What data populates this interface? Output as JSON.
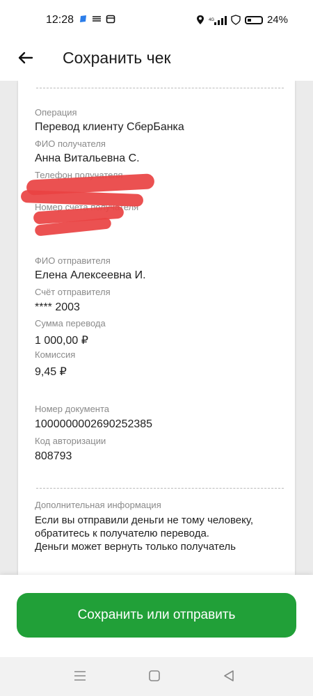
{
  "status_bar": {
    "time": "12:28",
    "battery": "24%"
  },
  "header": {
    "title": "Сохранить чек"
  },
  "receipt": {
    "operation_label": "Операция",
    "operation_value": "Перевод клиенту СберБанка",
    "recipient_name_label": "ФИО получателя",
    "recipient_name_value": "Анна Витальевна С.",
    "recipient_phone_label": "Телефон получателя",
    "recipient_account_label": "Номер счета получателя",
    "sender_name_label": "ФИО отправителя",
    "sender_name_value": "Елена Алексеевна И.",
    "sender_account_label": "Счёт отправителя",
    "sender_account_value": "**** 2003",
    "amount_label": "Сумма перевода",
    "amount_value": "1 000,00 ₽",
    "fee_label": "Комиссия",
    "fee_value": "9,45 ₽",
    "doc_number_label": "Номер документа",
    "doc_number_value": "1000000002690252385",
    "auth_code_label": "Код авторизации",
    "auth_code_value": "808793",
    "extra_info_label": "Дополнительная информация",
    "extra_info_line1": "Если вы отправили деньги не тому человеку,",
    "extra_info_line2": "обратитесь к получателю перевода.",
    "extra_info_line3": "Деньги может вернуть только получатель"
  },
  "footer": {
    "button_label": "Сохранить или отправить"
  },
  "colors": {
    "accent": "#21a038",
    "redaction": "#e94242"
  }
}
